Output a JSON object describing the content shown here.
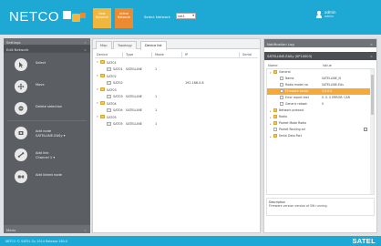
{
  "header": {
    "logo_text": "NETCO",
    "alarm_new": "New Network",
    "alarm_active": "Active Network",
    "network_label": "Select Network",
    "network_value": "net1",
    "user_name": "admin",
    "user_role": "admin",
    "colors": {
      "bar": "#1da9d3",
      "alarm_yellow": "#f0b63d",
      "alarm_orange": "#eb8a2e"
    }
  },
  "sidebar": {
    "settings": "Settings",
    "edit_network": "Edit Network",
    "items": [
      {
        "label": "Select",
        "icon": "cursor-icon"
      },
      {
        "label": "Move",
        "icon": "move-icon"
      },
      {
        "label": "Delete selection",
        "icon": "delete-icon"
      },
      {
        "label": "Add node",
        "sub": "SATELLINE-EASy",
        "icon": "add-node-icon"
      },
      {
        "label": "Add link",
        "sub": "Channel 1",
        "icon": "add-link-icon"
      },
      {
        "label": "Add linked node",
        "icon": "add-linked-node-icon"
      }
    ],
    "footer": "Menu"
  },
  "center": {
    "tabs": [
      "Map",
      "Topology",
      "Device list"
    ],
    "columns": [
      "Device",
      "Type",
      "Mode",
      "IP",
      "Serial"
    ],
    "rows": [
      {
        "level": 0,
        "kind": "folder",
        "device": "SAT01",
        "type": "",
        "mode": "",
        "ip": ""
      },
      {
        "level": 1,
        "kind": "node",
        "device": "SAT01",
        "type": "SATELLINE",
        "mode": "1",
        "ip": ""
      },
      {
        "level": 0,
        "kind": "folder",
        "device": "SAT02",
        "type": "",
        "mode": "",
        "ip": ""
      },
      {
        "level": 1,
        "kind": "node",
        "device": "SAT02",
        "type": "",
        "mode": "",
        "ip": "192.168.0.8"
      },
      {
        "level": 0,
        "kind": "folder",
        "device": "SAT03",
        "type": "",
        "mode": "",
        "ip": ""
      },
      {
        "level": 1,
        "kind": "node",
        "device": "SAT03",
        "type": "SATELLINE",
        "mode": "1",
        "ip": ""
      },
      {
        "level": 0,
        "kind": "folder",
        "device": "SAT04",
        "type": "",
        "mode": "",
        "ip": ""
      },
      {
        "level": 1,
        "kind": "node",
        "device": "SAT04",
        "type": "SATELLINE",
        "mode": "1",
        "ip": ""
      },
      {
        "level": 0,
        "kind": "folder",
        "device": "SAT05",
        "type": "",
        "mode": "",
        "ip": ""
      },
      {
        "level": 1,
        "kind": "node",
        "device": "SAT05",
        "type": "SATELLINE",
        "mode": "1",
        "ip": ""
      }
    ]
  },
  "right": {
    "notification_log": "Notification Log",
    "object_title": "SATELLINE-EASy (SP10003)",
    "columns": [
      "Name",
      "Value"
    ],
    "props": [
      {
        "level": 0,
        "tog": "▾",
        "kind": "folder",
        "name": "General",
        "value": ""
      },
      {
        "level": 1,
        "kind": "leaf",
        "name": "Name",
        "value": "SATELLINE_N"
      },
      {
        "level": 1,
        "kind": "leaf",
        "name": "Radio model na",
        "value": "SATELLINE-EAs"
      },
      {
        "level": 1,
        "kind": "leaf",
        "name": "Firmware versio",
        "value": "3.0.0.0",
        "hl": true
      },
      {
        "level": 1,
        "kind": "leaf",
        "name": "Error report text",
        "value": "0. 0. 0 ERROR: CAR"
      },
      {
        "level": 1,
        "kind": "leaf",
        "name": "Generic reboot",
        "value": "0"
      },
      {
        "level": 0,
        "tog": "▸",
        "kind": "folder",
        "name": "Network protocol",
        "value": ""
      },
      {
        "level": 0,
        "tog": "▸",
        "kind": "folder",
        "name": "Radio",
        "value": ""
      },
      {
        "level": 0,
        "tog": "▸",
        "kind": "folder",
        "name": "Packet Mode Radio",
        "value": ""
      },
      {
        "level": 0,
        "tog": "",
        "kind": "leaf",
        "name": "Packet Routing ad",
        "value": "",
        "check": true
      },
      {
        "level": 0,
        "tog": "▸",
        "kind": "folder",
        "name": "Serial Data Port",
        "value": ""
      }
    ],
    "description_label": "Description",
    "description_text": "Firmware version version of SW running."
  },
  "footer": {
    "copyright": "NETCO © SATEL Oy 2014 Release 180.0",
    "brand": "SATEL"
  }
}
